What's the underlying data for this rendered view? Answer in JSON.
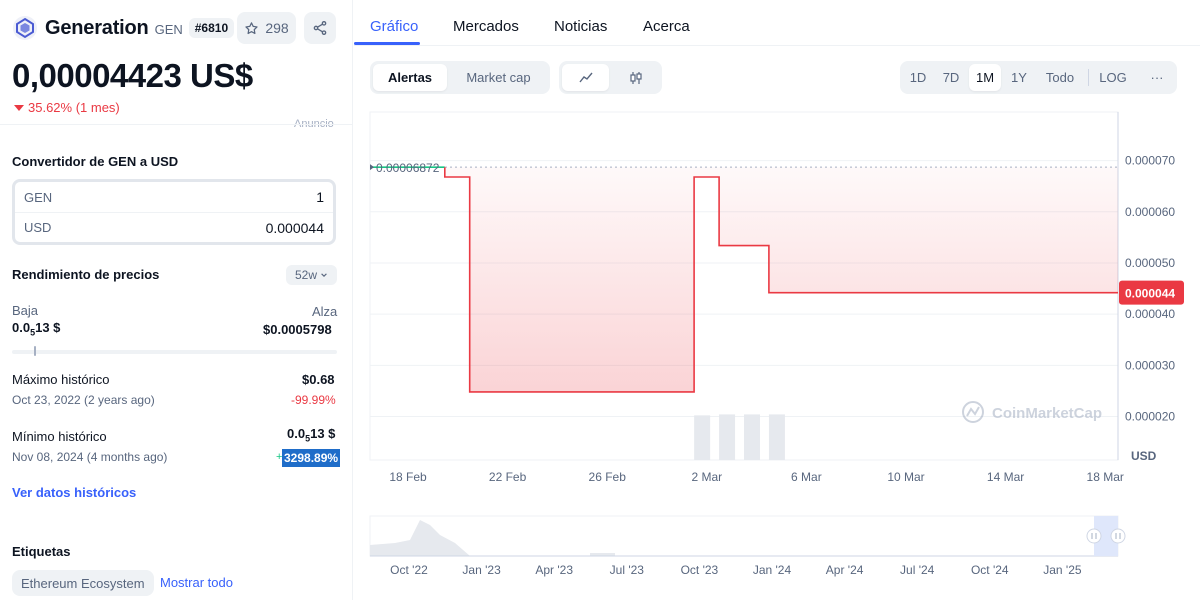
{
  "coin": {
    "name": "Generation",
    "symbol": "GEN",
    "rank": "#6810",
    "watchlist_count": "298",
    "price": "0,00004423 US$",
    "change": "35.62% (1 mes)",
    "ad_label": "Anuncio"
  },
  "converter": {
    "title": "Convertidor de GEN a USD",
    "from_label": "GEN",
    "from_value": "1",
    "to_label": "USD",
    "to_value": "0.000044"
  },
  "performance": {
    "title": "Rendimiento de precios",
    "period": "52w",
    "low_label": "Baja",
    "low_value": "0.0",
    "low_sub": "5",
    "low_rest": "13 $",
    "high_label": "Alza",
    "high_value": "$0.0005798",
    "ath_label": "Máximo histórico",
    "ath_value": "$0.68",
    "ath_date": "Oct 23, 2022 (2 years ago)",
    "ath_change": "-99.99%",
    "atl_label": "Mínimo histórico",
    "atl_value": "0.0",
    "atl_sub": "5",
    "atl_rest": "13 $",
    "atl_date": "Nov 08, 2024 (4 months ago)",
    "atl_change_sign": "+",
    "atl_change": "3298.89%",
    "historic_link": "Ver datos históricos"
  },
  "tags": {
    "title": "Etiquetas",
    "items": [
      "Ethereum Ecosystem"
    ],
    "show_all": "Mostrar todo"
  },
  "tabs": [
    "Gráfico",
    "Mercados",
    "Noticias",
    "Acerca"
  ],
  "toolbar": {
    "mode": [
      "Alertas",
      "Market cap"
    ],
    "ranges": [
      "1D",
      "7D",
      "1M",
      "1Y",
      "Todo"
    ],
    "log": "LOG",
    "more": "···"
  },
  "colors": {
    "accent": "#3861fb",
    "down": "#ea3943",
    "up": "#16c784"
  },
  "chart_data": {
    "type": "line",
    "unit": "USD",
    "watermark": "CoinMarketCap",
    "start_label": "0.00006872",
    "current_label": "0.000044",
    "y_ticks": [
      "0.000070",
      "0.000060",
      "0.000050",
      "0.000040",
      "0.000030",
      "0.000020"
    ],
    "y_tick_values": [
      7e-05,
      6e-05,
      5e-05,
      4e-05,
      3e-05,
      2e-05
    ],
    "x_ticks": [
      "18 Feb",
      "22 Feb",
      "26 Feb",
      "2 Mar",
      "6 Mar",
      "10 Mar",
      "14 Mar",
      "18 Mar"
    ],
    "ylim": [
      1.15e-05,
      7.95e-05
    ],
    "x_range": [
      "2025-02-16",
      "2025-03-18"
    ],
    "series": [
      {
        "points": [
          [
            "2025-02-16",
            6.872e-05
          ],
          [
            "2025-02-19",
            6.872e-05
          ],
          [
            "2025-02-19",
            6.68e-05
          ],
          [
            "2025-02-20",
            6.68e-05
          ],
          [
            "2025-02-20",
            2.48e-05
          ],
          [
            "2025-03-01",
            2.48e-05
          ],
          [
            "2025-03-01",
            6.68e-05
          ],
          [
            "2025-03-02",
            6.68e-05
          ],
          [
            "2025-03-02",
            5.34e-05
          ],
          [
            "2025-03-04",
            5.34e-05
          ],
          [
            "2025-03-04",
            4.42e-05
          ],
          [
            "2025-03-18",
            4.42e-05
          ]
        ]
      }
    ],
    "volume_bars": [
      [
        "2025-03-01",
        0.93
      ],
      [
        "2025-03-02",
        0.95
      ],
      [
        "2025-03-03",
        0.95
      ],
      [
        "2025-03-04",
        0.95
      ]
    ],
    "navigator_ticks": [
      "Oct '22",
      "Jan '23",
      "Apr '23",
      "Jul '23",
      "Oct '23",
      "Jan '24",
      "Apr '24",
      "Jul '24",
      "Oct '24",
      "Jan '25"
    ]
  }
}
